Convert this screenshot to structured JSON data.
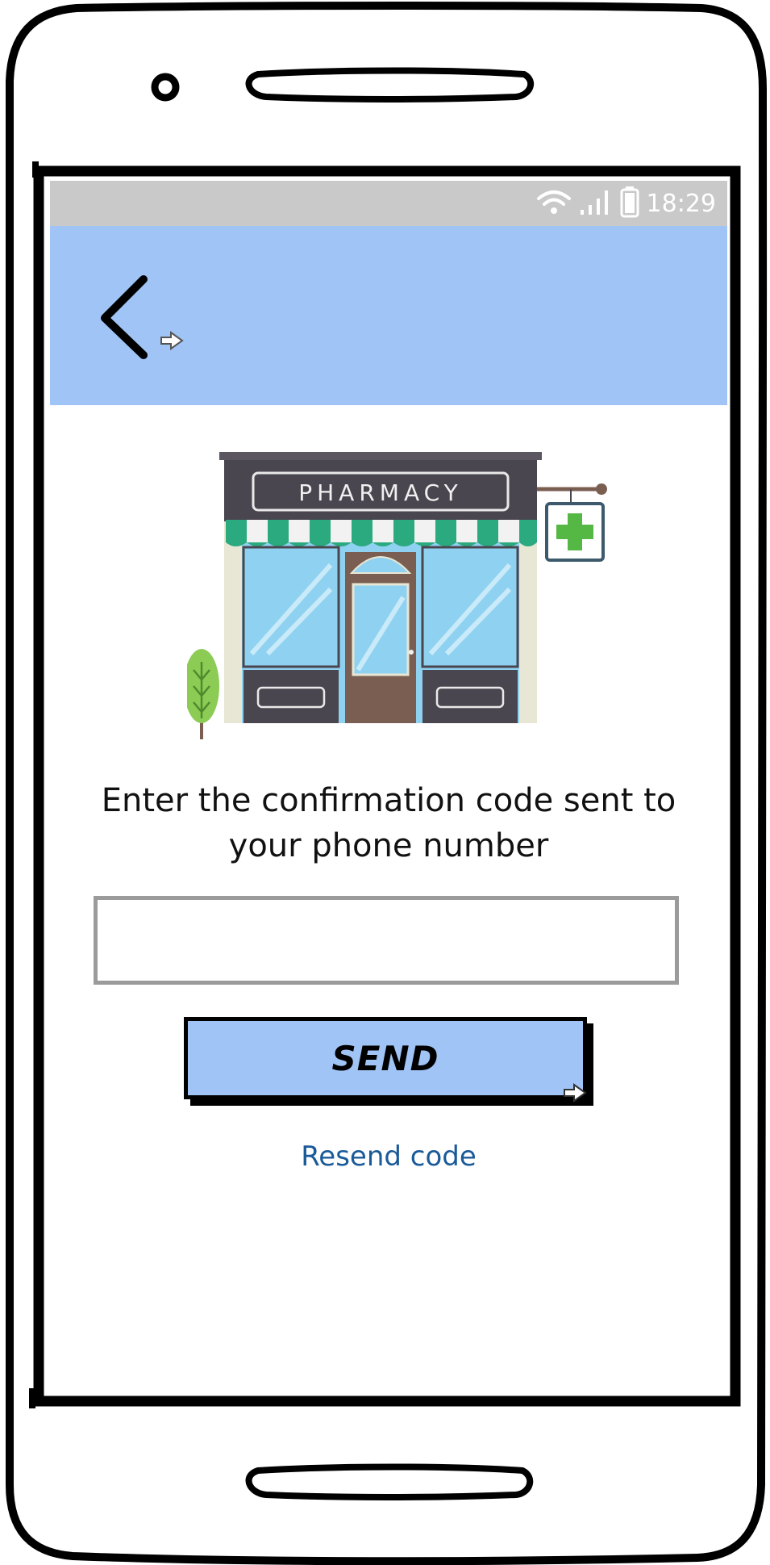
{
  "status_bar": {
    "time": "18:29",
    "icons": [
      "wifi-icon",
      "signal-icon",
      "battery-icon"
    ],
    "background": "#c9c9c9"
  },
  "header": {
    "background": "#a0c4f5",
    "back_icon": "chevron-left-icon"
  },
  "illustration": {
    "sign_text": "PHARMACY",
    "subject": "pharmacy-storefront"
  },
  "form": {
    "prompt": "Enter the confirmation code sent to your phone number",
    "code_value": "",
    "code_placeholder": "",
    "send_label": "SEND",
    "resend_label": "Resend code"
  },
  "colors": {
    "accent": "#a0c4f5",
    "link": "#1a5a99",
    "input_border": "#9b9b9b"
  }
}
